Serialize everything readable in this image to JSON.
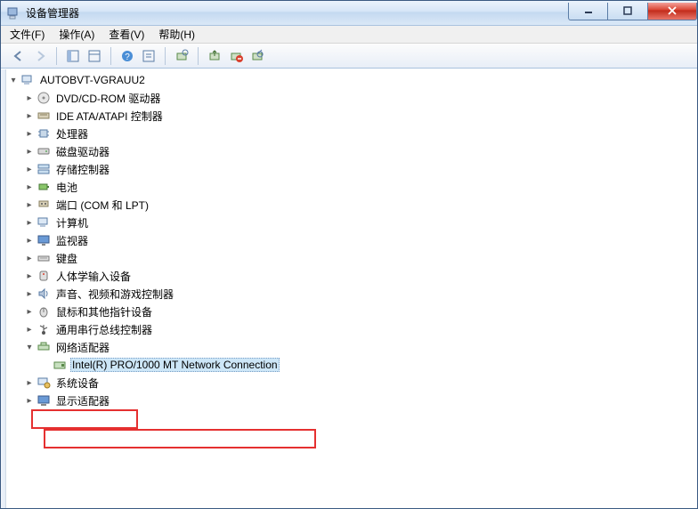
{
  "window": {
    "title": "设备管理器"
  },
  "menu": {
    "file": "文件(F)",
    "action": "操作(A)",
    "view": "查看(V)",
    "help": "帮助(H)"
  },
  "tree": {
    "root": "AUTOBVT-VGRAUU2",
    "nodes": [
      {
        "icon": "disc",
        "label": "DVD/CD-ROM 驱动器"
      },
      {
        "icon": "ide",
        "label": "IDE ATA/ATAPI 控制器"
      },
      {
        "icon": "cpu",
        "label": "处理器"
      },
      {
        "icon": "disk",
        "label": "磁盘驱动器"
      },
      {
        "icon": "storage",
        "label": "存储控制器"
      },
      {
        "icon": "battery",
        "label": "电池"
      },
      {
        "icon": "port",
        "label": "端口 (COM 和 LPT)"
      },
      {
        "icon": "computer",
        "label": "计算机"
      },
      {
        "icon": "monitor",
        "label": "监视器"
      },
      {
        "icon": "keyboard",
        "label": "键盘"
      },
      {
        "icon": "hid",
        "label": "人体学输入设备"
      },
      {
        "icon": "sound",
        "label": "声音、视频和游戏控制器"
      },
      {
        "icon": "mouse",
        "label": "鼠标和其他指针设备"
      },
      {
        "icon": "usb",
        "label": "通用串行总线控制器"
      }
    ],
    "network_label": "网络适配器",
    "network_child": "Intel(R) PRO/1000 MT Network Connection",
    "tail": [
      {
        "icon": "system",
        "label": "系统设备"
      },
      {
        "icon": "display",
        "label": "显示适配器"
      }
    ]
  }
}
